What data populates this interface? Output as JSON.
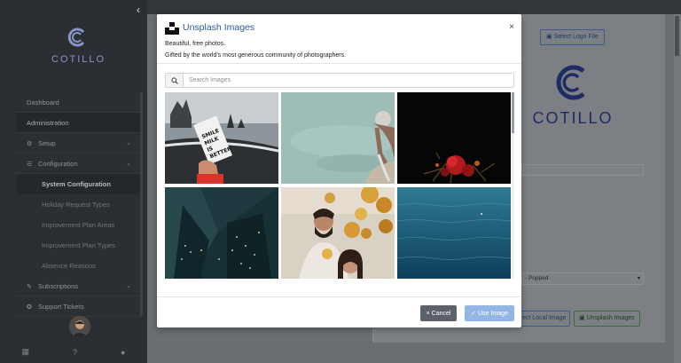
{
  "sidebar": {
    "logo_text": "COTILLO",
    "collapse_icon": "chevron-left-icon",
    "items": [
      {
        "label": "Dashboard"
      },
      {
        "label": "Administration"
      },
      {
        "label": "Setup"
      },
      {
        "label": "Configuration"
      },
      {
        "label": "System Configuration"
      },
      {
        "label": "Holiday Request Types"
      },
      {
        "label": "Improvement Plan Areas"
      },
      {
        "label": "Improvement Plan Types"
      },
      {
        "label": "Absence Reasons"
      },
      {
        "label": "Subscriptions"
      },
      {
        "label": "Support Tickets"
      }
    ],
    "footer_icons": [
      "grid-icon",
      "question-icon",
      "bell-icon"
    ]
  },
  "background": {
    "select_logo_label": "Select Logo File",
    "logo_text": "COTILLO",
    "select_value": "- Popped",
    "local_image_label": "ect Local Image",
    "unsplash_button_label": "Unsplash Images"
  },
  "modal": {
    "title": "Unsplash Images",
    "close_glyph": "×",
    "description_line1": "Beautiful, free photos.",
    "description_line2": "Gifted by the world's most generous community of photographers.",
    "search_placeholder": "Search Images",
    "images": [
      {
        "subject": "hand holding white milk carton on black sand beach"
      },
      {
        "subject": "person reaching into calm teal water"
      },
      {
        "subject": "red roses on black background"
      },
      {
        "subject": "aerial view of night city skyscrapers"
      },
      {
        "subject": "couple portrait with yellow flowers"
      },
      {
        "subject": "deep blue ocean water"
      }
    ],
    "cancel_label": "Cancel",
    "cancel_glyph": "×",
    "use_label": "Use Image",
    "use_glyph": "✓"
  },
  "colors": {
    "title_blue": "#2c5aa0",
    "cancel_bg": "#5b6167",
    "use_bg": "#93b7e4"
  }
}
